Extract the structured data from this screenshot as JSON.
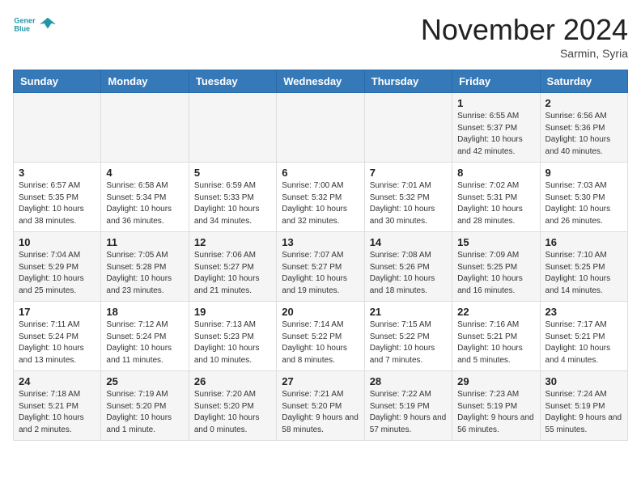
{
  "header": {
    "logo_line1": "General",
    "logo_line2": "Blue",
    "month": "November 2024",
    "location": "Sarmin, Syria"
  },
  "weekdays": [
    "Sunday",
    "Monday",
    "Tuesday",
    "Wednesday",
    "Thursday",
    "Friday",
    "Saturday"
  ],
  "weeks": [
    [
      {
        "day": "",
        "info": ""
      },
      {
        "day": "",
        "info": ""
      },
      {
        "day": "",
        "info": ""
      },
      {
        "day": "",
        "info": ""
      },
      {
        "day": "",
        "info": ""
      },
      {
        "day": "1",
        "info": "Sunrise: 6:55 AM\nSunset: 5:37 PM\nDaylight: 10 hours and 42 minutes."
      },
      {
        "day": "2",
        "info": "Sunrise: 6:56 AM\nSunset: 5:36 PM\nDaylight: 10 hours and 40 minutes."
      }
    ],
    [
      {
        "day": "3",
        "info": "Sunrise: 6:57 AM\nSunset: 5:35 PM\nDaylight: 10 hours and 38 minutes."
      },
      {
        "day": "4",
        "info": "Sunrise: 6:58 AM\nSunset: 5:34 PM\nDaylight: 10 hours and 36 minutes."
      },
      {
        "day": "5",
        "info": "Sunrise: 6:59 AM\nSunset: 5:33 PM\nDaylight: 10 hours and 34 minutes."
      },
      {
        "day": "6",
        "info": "Sunrise: 7:00 AM\nSunset: 5:32 PM\nDaylight: 10 hours and 32 minutes."
      },
      {
        "day": "7",
        "info": "Sunrise: 7:01 AM\nSunset: 5:32 PM\nDaylight: 10 hours and 30 minutes."
      },
      {
        "day": "8",
        "info": "Sunrise: 7:02 AM\nSunset: 5:31 PM\nDaylight: 10 hours and 28 minutes."
      },
      {
        "day": "9",
        "info": "Sunrise: 7:03 AM\nSunset: 5:30 PM\nDaylight: 10 hours and 26 minutes."
      }
    ],
    [
      {
        "day": "10",
        "info": "Sunrise: 7:04 AM\nSunset: 5:29 PM\nDaylight: 10 hours and 25 minutes."
      },
      {
        "day": "11",
        "info": "Sunrise: 7:05 AM\nSunset: 5:28 PM\nDaylight: 10 hours and 23 minutes."
      },
      {
        "day": "12",
        "info": "Sunrise: 7:06 AM\nSunset: 5:27 PM\nDaylight: 10 hours and 21 minutes."
      },
      {
        "day": "13",
        "info": "Sunrise: 7:07 AM\nSunset: 5:27 PM\nDaylight: 10 hours and 19 minutes."
      },
      {
        "day": "14",
        "info": "Sunrise: 7:08 AM\nSunset: 5:26 PM\nDaylight: 10 hours and 18 minutes."
      },
      {
        "day": "15",
        "info": "Sunrise: 7:09 AM\nSunset: 5:25 PM\nDaylight: 10 hours and 16 minutes."
      },
      {
        "day": "16",
        "info": "Sunrise: 7:10 AM\nSunset: 5:25 PM\nDaylight: 10 hours and 14 minutes."
      }
    ],
    [
      {
        "day": "17",
        "info": "Sunrise: 7:11 AM\nSunset: 5:24 PM\nDaylight: 10 hours and 13 minutes."
      },
      {
        "day": "18",
        "info": "Sunrise: 7:12 AM\nSunset: 5:24 PM\nDaylight: 10 hours and 11 minutes."
      },
      {
        "day": "19",
        "info": "Sunrise: 7:13 AM\nSunset: 5:23 PM\nDaylight: 10 hours and 10 minutes."
      },
      {
        "day": "20",
        "info": "Sunrise: 7:14 AM\nSunset: 5:22 PM\nDaylight: 10 hours and 8 minutes."
      },
      {
        "day": "21",
        "info": "Sunrise: 7:15 AM\nSunset: 5:22 PM\nDaylight: 10 hours and 7 minutes."
      },
      {
        "day": "22",
        "info": "Sunrise: 7:16 AM\nSunset: 5:21 PM\nDaylight: 10 hours and 5 minutes."
      },
      {
        "day": "23",
        "info": "Sunrise: 7:17 AM\nSunset: 5:21 PM\nDaylight: 10 hours and 4 minutes."
      }
    ],
    [
      {
        "day": "24",
        "info": "Sunrise: 7:18 AM\nSunset: 5:21 PM\nDaylight: 10 hours and 2 minutes."
      },
      {
        "day": "25",
        "info": "Sunrise: 7:19 AM\nSunset: 5:20 PM\nDaylight: 10 hours and 1 minute."
      },
      {
        "day": "26",
        "info": "Sunrise: 7:20 AM\nSunset: 5:20 PM\nDaylight: 10 hours and 0 minutes."
      },
      {
        "day": "27",
        "info": "Sunrise: 7:21 AM\nSunset: 5:20 PM\nDaylight: 9 hours and 58 minutes."
      },
      {
        "day": "28",
        "info": "Sunrise: 7:22 AM\nSunset: 5:19 PM\nDaylight: 9 hours and 57 minutes."
      },
      {
        "day": "29",
        "info": "Sunrise: 7:23 AM\nSunset: 5:19 PM\nDaylight: 9 hours and 56 minutes."
      },
      {
        "day": "30",
        "info": "Sunrise: 7:24 AM\nSunset: 5:19 PM\nDaylight: 9 hours and 55 minutes."
      }
    ]
  ]
}
